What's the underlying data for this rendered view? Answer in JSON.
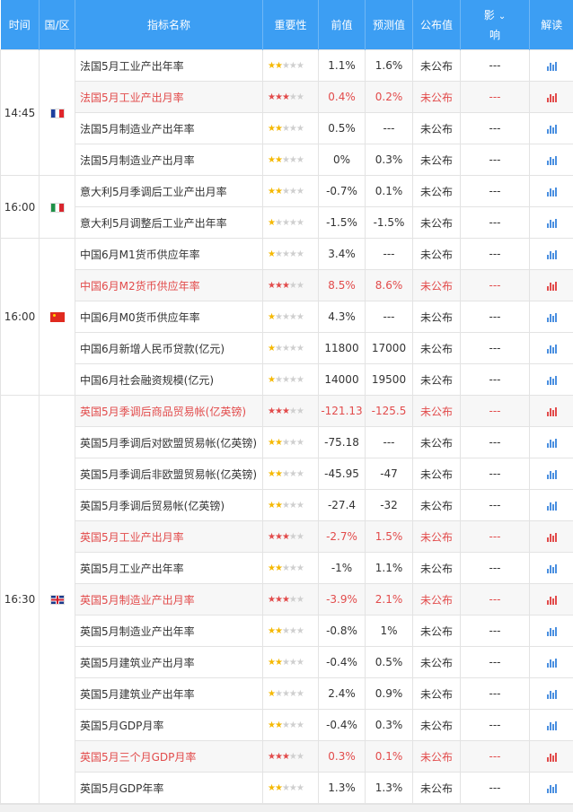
{
  "header": {
    "time": "时间",
    "region": "国/区",
    "name": "指标名称",
    "importance": "重要性",
    "previous": "前值",
    "forecast": "预测值",
    "actual": "公布值",
    "impact_line1": "影",
    "impact_line2": "响",
    "interpret": "解读"
  },
  "colors": {
    "header_bg": "#3c9ef3",
    "highlight_text": "#e24b4b",
    "star_on": "#f5b800"
  },
  "groups": [
    {
      "time": "14:45",
      "flag": "france-flag-icon",
      "rows": [
        {
          "name": "法国5月工业产出年率",
          "stars": 2,
          "prev": "1.1%",
          "fc": "1.6%",
          "actual": "未公布",
          "impact": "---",
          "hi": false
        },
        {
          "name": "法国5月工业产出月率",
          "stars": 3,
          "prev": "0.4%",
          "fc": "0.2%",
          "actual": "未公布",
          "impact": "---",
          "hi": true
        },
        {
          "name": "法国5月制造业产出年率",
          "stars": 2,
          "prev": "0.5%",
          "fc": "---",
          "actual": "未公布",
          "impact": "---",
          "hi": false
        },
        {
          "name": "法国5月制造业产出月率",
          "stars": 2,
          "prev": "0%",
          "fc": "0.3%",
          "actual": "未公布",
          "impact": "---",
          "hi": false
        }
      ]
    },
    {
      "time": "16:00",
      "flag": "italy-flag-icon",
      "rows": [
        {
          "name": "意大利5月季调后工业产出月率",
          "stars": 2,
          "prev": "-0.7%",
          "fc": "0.1%",
          "actual": "未公布",
          "impact": "---",
          "hi": false
        },
        {
          "name": "意大利5月调整后工业产出年率",
          "stars": 1,
          "prev": "-1.5%",
          "fc": "-1.5%",
          "actual": "未公布",
          "impact": "---",
          "hi": false
        }
      ]
    },
    {
      "time": "16:00",
      "flag": "china-flag-icon",
      "rows": [
        {
          "name": "中国6月M1货币供应年率",
          "stars": 1,
          "prev": "3.4%",
          "fc": "---",
          "actual": "未公布",
          "impact": "---",
          "hi": false
        },
        {
          "name": "中国6月M2货币供应年率",
          "stars": 3,
          "prev": "8.5%",
          "fc": "8.6%",
          "actual": "未公布",
          "impact": "---",
          "hi": true
        },
        {
          "name": "中国6月M0货币供应年率",
          "stars": 1,
          "prev": "4.3%",
          "fc": "---",
          "actual": "未公布",
          "impact": "---",
          "hi": false
        },
        {
          "name": "中国6月新增人民币贷款(亿元)",
          "stars": 1,
          "prev": "11800",
          "fc": "17000",
          "actual": "未公布",
          "impact": "---",
          "hi": false
        },
        {
          "name": "中国6月社会融资规模(亿元)",
          "stars": 1,
          "prev": "14000",
          "fc": "19500",
          "actual": "未公布",
          "impact": "---",
          "hi": false
        }
      ]
    },
    {
      "time": "16:30",
      "flag": "uk-flag-icon",
      "rows": [
        {
          "name": "英国5月季调后商品贸易帐(亿英镑)",
          "stars": 3,
          "prev": "-121.13",
          "fc": "-125.5",
          "actual": "未公布",
          "impact": "---",
          "hi": true
        },
        {
          "name": "英国5月季调后对欧盟贸易帐(亿英镑)",
          "stars": 2,
          "prev": "-75.18",
          "fc": "---",
          "actual": "未公布",
          "impact": "---",
          "hi": false
        },
        {
          "name": "英国5月季调后非欧盟贸易帐(亿英镑)",
          "stars": 2,
          "prev": "-45.95",
          "fc": "-47",
          "actual": "未公布",
          "impact": "---",
          "hi": false
        },
        {
          "name": "英国5月季调后贸易帐(亿英镑)",
          "stars": 2,
          "prev": "-27.4",
          "fc": "-32",
          "actual": "未公布",
          "impact": "---",
          "hi": false
        },
        {
          "name": "英国5月工业产出月率",
          "stars": 3,
          "prev": "-2.7%",
          "fc": "1.5%",
          "actual": "未公布",
          "impact": "---",
          "hi": true
        },
        {
          "name": "英国5月工业产出年率",
          "stars": 2,
          "prev": "-1%",
          "fc": "1.1%",
          "actual": "未公布",
          "impact": "---",
          "hi": false
        },
        {
          "name": "英国5月制造业产出月率",
          "stars": 3,
          "prev": "-3.9%",
          "fc": "2.1%",
          "actual": "未公布",
          "impact": "---",
          "hi": true
        },
        {
          "name": "英国5月制造业产出年率",
          "stars": 2,
          "prev": "-0.8%",
          "fc": "1%",
          "actual": "未公布",
          "impact": "---",
          "hi": false
        },
        {
          "name": "英国5月建筑业产出月率",
          "stars": 2,
          "prev": "-0.4%",
          "fc": "0.5%",
          "actual": "未公布",
          "impact": "---",
          "hi": false
        },
        {
          "name": "英国5月建筑业产出年率",
          "stars": 1,
          "prev": "2.4%",
          "fc": "0.9%",
          "actual": "未公布",
          "impact": "---",
          "hi": false
        },
        {
          "name": "英国5月GDP月率",
          "stars": 2,
          "prev": "-0.4%",
          "fc": "0.3%",
          "actual": "未公布",
          "impact": "---",
          "hi": false
        },
        {
          "name": "英国5月三个月GDP月率",
          "stars": 3,
          "prev": "0.3%",
          "fc": "0.1%",
          "actual": "未公布",
          "impact": "---",
          "hi": true
        },
        {
          "name": "英国5月GDP年率",
          "stars": 2,
          "prev": "1.3%",
          "fc": "1.3%",
          "actual": "未公布",
          "impact": "---",
          "hi": false
        }
      ]
    }
  ]
}
